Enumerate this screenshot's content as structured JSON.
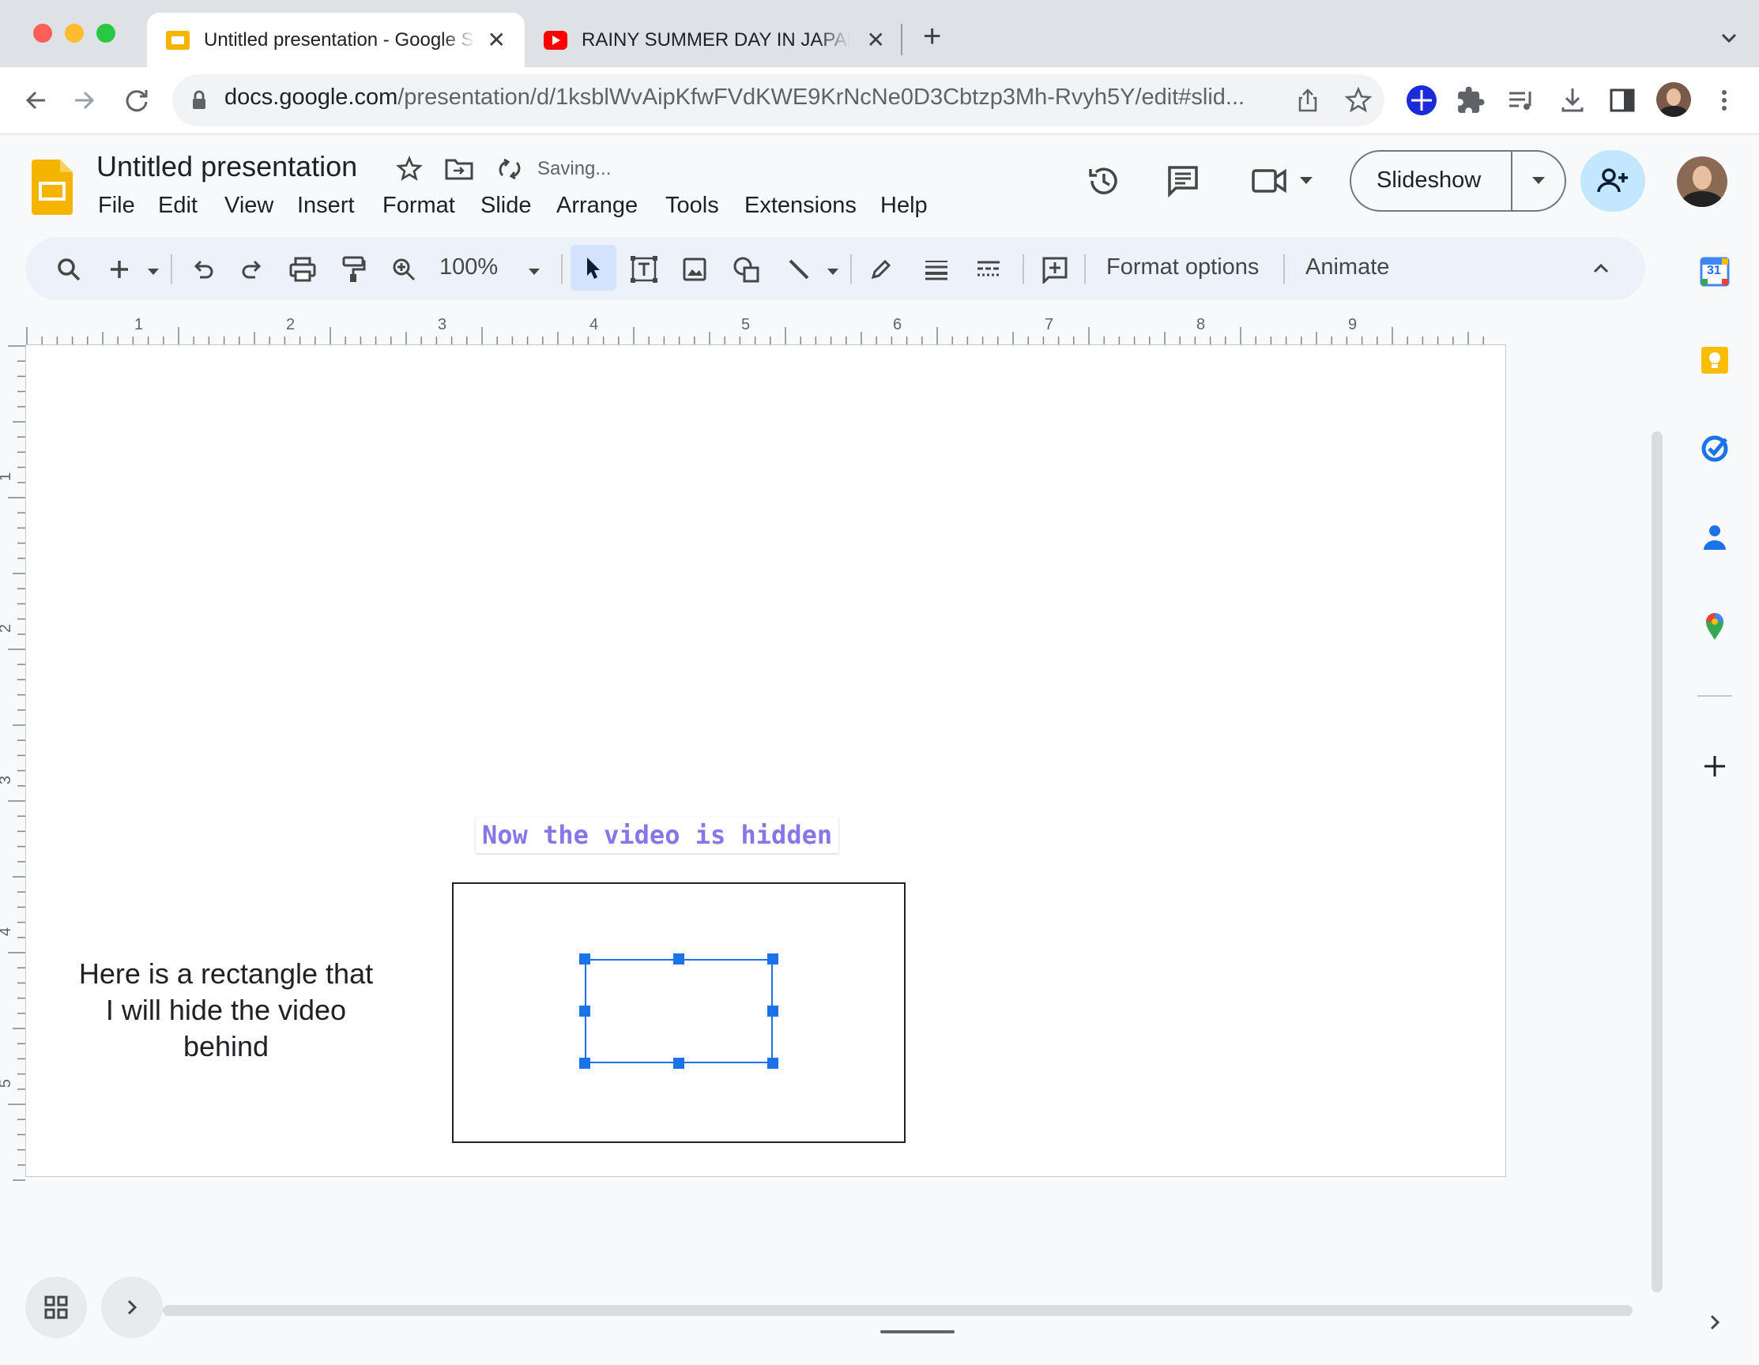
{
  "browser": {
    "tabs": [
      {
        "title": "Untitled presentation - Google Slides",
        "active": true,
        "favicon_color": "#f4b400"
      },
      {
        "title": "RAINY SUMMER DAY IN JAPAN",
        "active": false,
        "favicon_color": "#ff0000"
      }
    ],
    "close_glyph": "✕",
    "new_tab_glyph": "+",
    "url_host": "docs.google.com",
    "url_path": "/presentation/d/1ksblWvAipKfwFVdKWE9KrNcNe0D3Cbtzp3Mh-Rvyh5Y/edit#slid..."
  },
  "doc": {
    "title": "Untitled presentation",
    "status": "Saving...",
    "menu": [
      "File",
      "Edit",
      "View",
      "Insert",
      "Format",
      "Slide",
      "Arrange",
      "Tools",
      "Extensions",
      "Help"
    ],
    "slideshow_label": "Slideshow",
    "zoom": "100%",
    "format_options_label": "Format options",
    "animate_label": "Animate"
  },
  "ruler": {
    "horizontal_marks": [
      "1",
      "2",
      "3",
      "4",
      "5",
      "6",
      "7",
      "8",
      "9"
    ],
    "vertical_marks": [
      "1",
      "2",
      "3",
      "4",
      "5"
    ]
  },
  "slide": {
    "caption": "Now the video is hidden",
    "left_text": "Here is a rectangle that I will hide the video behind"
  },
  "side_panel": {
    "calendar_day": "31"
  },
  "colors": {
    "accent_blue": "#1a73e8",
    "caption_color": "#8577e8",
    "slides_yellow": "#f4b400",
    "share_button_bg": "#c2e7ff"
  }
}
